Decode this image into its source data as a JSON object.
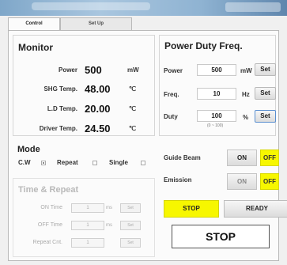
{
  "tabs": {
    "control": "Control",
    "setup": "Set Up"
  },
  "monitor": {
    "title": "Monitor",
    "rows": [
      {
        "label": "Power",
        "value": "500",
        "unit": "mW"
      },
      {
        "label": "SHG Temp.",
        "value": "48.00",
        "unit": "℃"
      },
      {
        "label": "L.D Temp.",
        "value": "20.00",
        "unit": "℃"
      },
      {
        "label": "Driver Temp.",
        "value": "24.50",
        "unit": "℃"
      }
    ]
  },
  "power_duty": {
    "title": "Power Duty Freq.",
    "rows": [
      {
        "label": "Power",
        "value": "500",
        "unit": "mW",
        "button": "Set"
      },
      {
        "label": "Freq.",
        "value": "10",
        "unit": "Hz",
        "button": "Set"
      },
      {
        "label": "Duty",
        "value": "100",
        "unit": "%",
        "button": "Set"
      }
    ],
    "duty_hint": "(0 ~ 100)"
  },
  "mode": {
    "title": "Mode",
    "options": [
      {
        "label": "C.W",
        "checked": true
      },
      {
        "label": "Repeat",
        "checked": false
      },
      {
        "label": "Single",
        "checked": false
      }
    ]
  },
  "time_repeat": {
    "title": "Time & Repeat",
    "rows": [
      {
        "label": "ON Time",
        "value": "1",
        "sep": "ms",
        "button": "Set"
      },
      {
        "label": "OFF Time",
        "value": "1",
        "sep": "ms",
        "button": "Set"
      },
      {
        "label": "Repeat Cnt.",
        "value": "1",
        "sep": "",
        "button": "Set"
      }
    ]
  },
  "guide_beam": {
    "label": "Guide Beam",
    "on": "ON",
    "off": "OFF"
  },
  "emission": {
    "label": "Emission",
    "on": "ON",
    "off": "OFF"
  },
  "actions": {
    "stop_small": "STOP",
    "ready": "READY",
    "stop_big": "STOP"
  },
  "colors": {
    "yellow": "#f7f700",
    "panel": "#fbfbfb",
    "border": "#b9b9b9"
  }
}
